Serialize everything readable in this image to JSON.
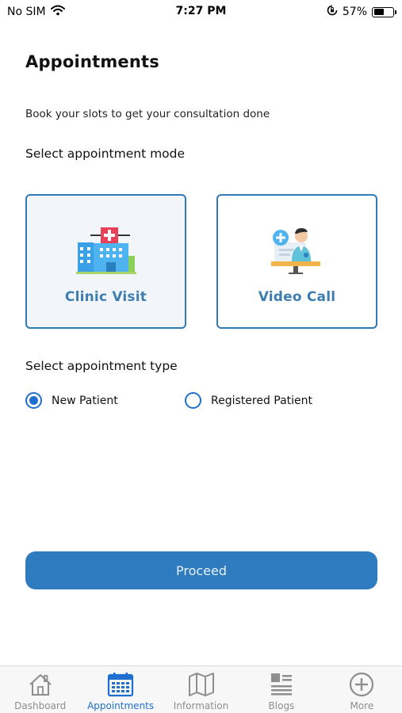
{
  "status_bar": {
    "carrier": "No SIM",
    "time": "7:27 PM",
    "battery_percent": "57%",
    "battery_level": 0.57
  },
  "page": {
    "title": "Appointments",
    "subtitle": "Book your slots to get your consultation done"
  },
  "mode_section": {
    "label": "Select appointment mode",
    "options": [
      {
        "label": "Clinic Visit",
        "icon": "hospital-icon",
        "selected": true
      },
      {
        "label": "Video Call",
        "icon": "doctor-video-icon",
        "selected": false
      }
    ]
  },
  "type_section": {
    "label": "Select appointment type",
    "options": [
      {
        "label": "New Patient",
        "selected": true
      },
      {
        "label": "Registered Patient",
        "selected": false
      }
    ]
  },
  "proceed_label": "Proceed",
  "tab_bar": {
    "items": [
      {
        "label": "Dashboard",
        "icon": "home-icon",
        "active": false
      },
      {
        "label": "Appointments",
        "icon": "calendar-icon",
        "active": true
      },
      {
        "label": "Information",
        "icon": "map-icon",
        "active": false
      },
      {
        "label": "Blogs",
        "icon": "article-icon",
        "active": false
      },
      {
        "label": "More",
        "icon": "plus-circle-icon",
        "active": false
      }
    ]
  },
  "colors": {
    "accent": "#2e7bbf",
    "card_border": "#2e7bb8",
    "active_tab": "#1e6fd0"
  }
}
